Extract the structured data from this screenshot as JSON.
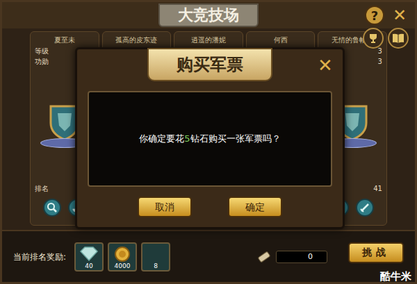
{
  "window": {
    "title": "大竞技场",
    "help": "?",
    "close": "✕"
  },
  "players": [
    {
      "name": "夏至未"
    },
    {
      "name": "孤高的皮东迹"
    },
    {
      "name": "逍遥的潘妮"
    },
    {
      "name": "何西"
    },
    {
      "name": "无情的鲁帕斯",
      "level": "3",
      "merit": "3",
      "rank": "41"
    }
  ],
  "stat_labels": {
    "level": "等级",
    "merit": "功勋",
    "rank": "排名"
  },
  "modal": {
    "title": "购买军票",
    "close": "✕",
    "message_before": "你确定要花",
    "cost": "5",
    "message_after": "钻石购买一张军票吗？",
    "buttons": [
      {
        "label": "取消"
      },
      {
        "label": "确定"
      }
    ]
  },
  "bottom": {
    "reward_label": "当前排名奖励:",
    "rewards": [
      {
        "count": "40",
        "kind": "diamond"
      },
      {
        "count": "4000",
        "kind": "gold"
      },
      {
        "count": "8",
        "kind": "empty"
      }
    ],
    "tickets": "0",
    "challenge": "挑战"
  },
  "watermark": "酷牛米"
}
